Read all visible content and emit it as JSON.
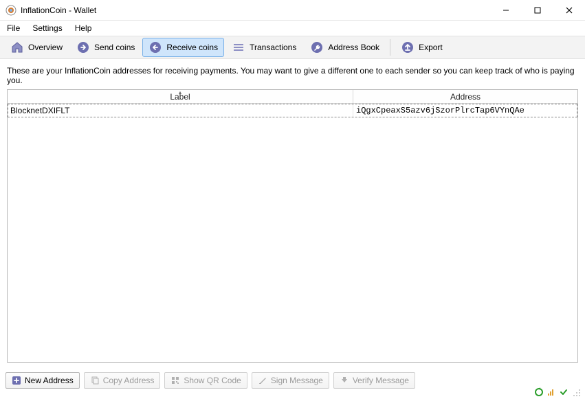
{
  "window": {
    "title": "InflationCoin - Wallet"
  },
  "menu": {
    "file": "File",
    "settings": "Settings",
    "help": "Help"
  },
  "toolbar": {
    "overview": "Overview",
    "send": "Send coins",
    "receive": "Receive coins",
    "transactions": "Transactions",
    "addressbook": "Address Book",
    "export": "Export"
  },
  "receive": {
    "description": "These are your InflationCoin addresses for receiving payments. You may want to give a different one to each sender so you can keep track of who is paying you.",
    "columns": {
      "label": "Label",
      "address": "Address"
    },
    "rows": [
      {
        "label": "BlocknetDXIFLT",
        "address": "iQgxCpeaxS5azv6jSzorPlrcTap6VYnQAe"
      }
    ]
  },
  "buttons": {
    "new_address": "New Address",
    "copy_address": "Copy Address",
    "show_qr": "Show QR Code",
    "sign_message": "Sign Message",
    "verify_message": "Verify Message"
  }
}
